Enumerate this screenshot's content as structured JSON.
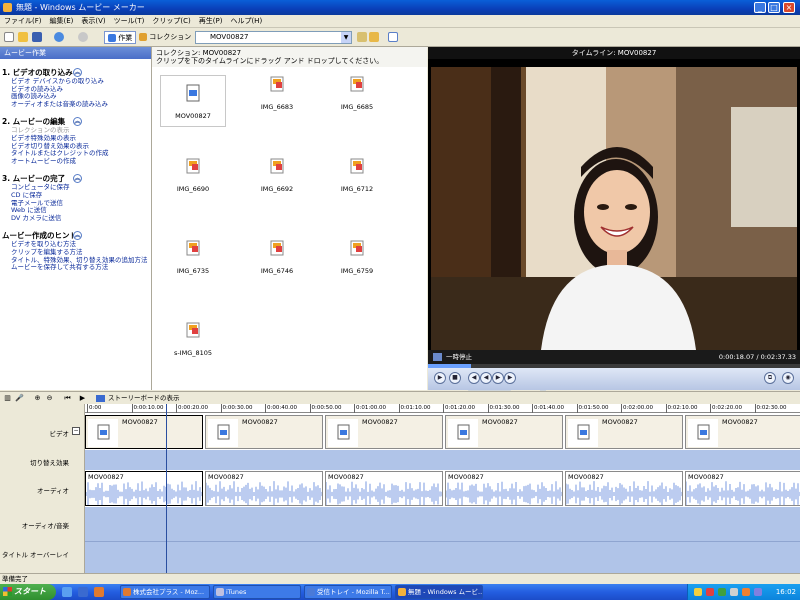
{
  "window": {
    "title": "無題 - Windows ムービー メーカー"
  },
  "menu": [
    "ファイル(F)",
    "編集(E)",
    "表示(V)",
    "ツール(T)",
    "クリップ(C)",
    "再生(P)",
    "ヘルプ(H)"
  ],
  "toolbar": {
    "tasks_label": "作業",
    "collections_label": "コレクション",
    "collection_value": "MOV00827"
  },
  "tasks": {
    "header": "ムービー作業",
    "sections": [
      {
        "title": "1. ビデオの取り込み",
        "items": [
          "ビデオ デバイスからの取り込み",
          "ビデオの読み込み",
          "画像の読み込み",
          "オーディオまたは音楽の読み込み"
        ]
      },
      {
        "title": "2. ムービーの編集",
        "items": [
          "コレクションの表示",
          "ビデオ特殊効果の表示",
          "ビデオ切り替え効果の表示",
          "タイトルまたはクレジットの作成",
          "オートムービーの作成"
        ]
      },
      {
        "title": "3. ムービーの完了",
        "items": [
          "コンピュータに保存",
          "CD に保存",
          "電子メールで送信",
          "Web に送信",
          "DV カメラに送信"
        ]
      },
      {
        "title": "ムービー作成のヒント",
        "items": [
          "ビデオを取り込む方法",
          "クリップを編集する方法",
          "タイトル、特殊効果、切り替え効果の追加方法",
          "ムービーを保存して共有する方法"
        ]
      }
    ]
  },
  "collection": {
    "title": "コレクション: MOV00827",
    "hint": "クリップを下のタイムラインにドラッグ アンド ドロップしてください。",
    "clips": [
      "MOV00827",
      "IMG_6683",
      "IMG_6685",
      "IMG_6690",
      "IMG_6692",
      "IMG_6712",
      "IMG_6735",
      "IMG_6746",
      "IMG_6759",
      "s-IMG_8105"
    ]
  },
  "preview": {
    "title": "タイムライン: MOV00827",
    "status": "一時停止",
    "time": "0:00:18.07 / 0:02:37.33",
    "progress": 0.115
  },
  "timeline": {
    "storyboard_label": "ストーリーボードの表示",
    "ruler": [
      "0:00",
      "0:00:10.00",
      "0:00:20.00",
      "0:00:30.00",
      "0:00:40.00",
      "0:00:50.00",
      "0:01:00.00",
      "0:01:10.00",
      "0:01:20.00",
      "0:01:30.00",
      "0:01:40.00",
      "0:01:50.00",
      "0:02:00.00",
      "0:02:10.00",
      "0:02:20.00",
      "0:02:30.00"
    ],
    "tracks": [
      "ビデオ",
      "切り替え効果",
      "オーディオ",
      "オーディオ/音楽",
      "タイトル オーバーレイ"
    ],
    "video_clips": [
      "MOV00827",
      "MOV00827",
      "MOV00827",
      "MOV00827",
      "MOV00827",
      "MOV00827"
    ],
    "audio_clips": [
      "MOV00827",
      "MOV00827",
      "MOV00827",
      "MOV00827",
      "MOV00827",
      "MOV00827"
    ]
  },
  "status": {
    "text": "準備完了"
  },
  "taskbar": {
    "start": "スタート",
    "items": [
      "株式会社プラス - Moz...",
      "iTunes",
      "受信トレイ - Mozilla T...",
      "無題 - Windows ムービ..."
    ],
    "clock": "16:02"
  }
}
